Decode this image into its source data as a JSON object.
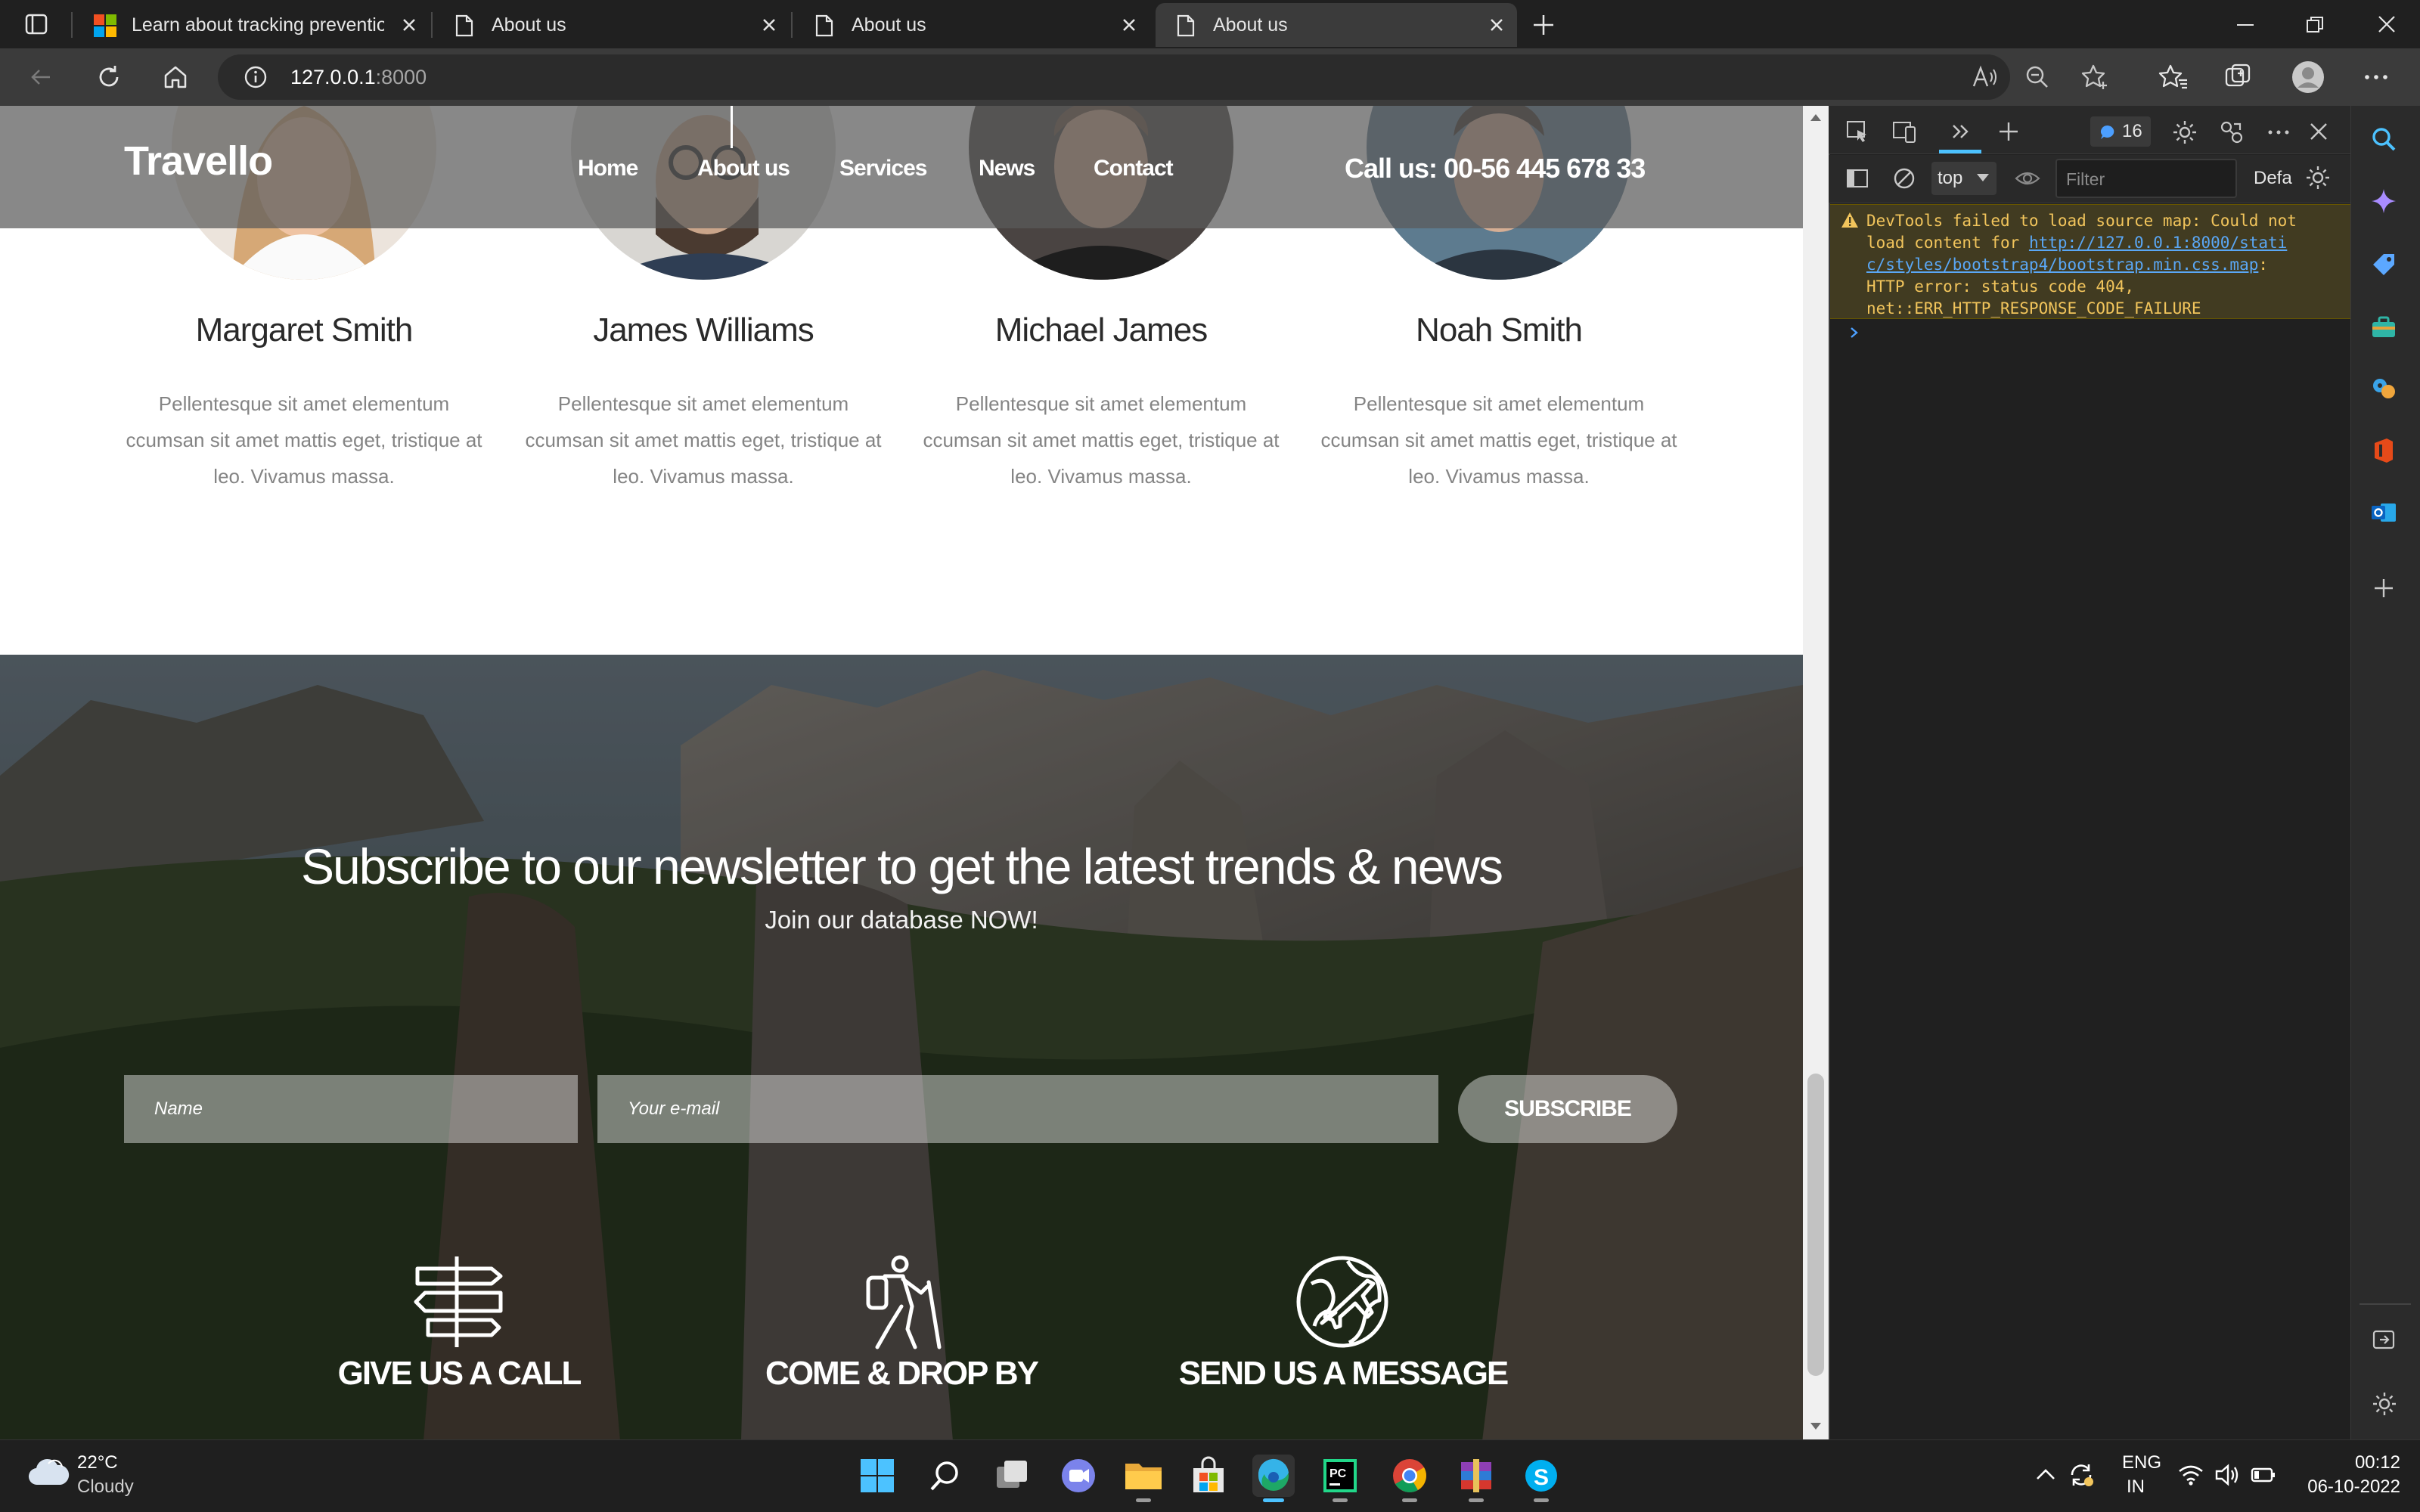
{
  "browser": {
    "tabs": [
      {
        "title": "Learn about tracking prevention"
      },
      {
        "title": "About us"
      },
      {
        "title": "About us"
      },
      {
        "title": "About us"
      }
    ],
    "url_host": "127.0.0.1",
    "url_port": ":8000"
  },
  "site": {
    "logo": "Travello",
    "nav": [
      "Home",
      "About us",
      "Services",
      "News",
      "Contact"
    ],
    "phone": "Call us: 00-56 445 678 33",
    "team": [
      {
        "name": "Margaret Smith",
        "desc": "Pellentesque sit amet elementum ccumsan sit amet mattis eget, tristique at leo. Vivamus massa."
      },
      {
        "name": "James Williams",
        "desc": "Pellentesque sit amet elementum ccumsan sit amet mattis eget, tristique at leo. Vivamus massa."
      },
      {
        "name": "Michael James",
        "desc": "Pellentesque sit amet elementum ccumsan sit amet mattis eget, tristique at leo. Vivamus massa."
      },
      {
        "name": "Noah Smith",
        "desc": "Pellentesque sit amet elementum ccumsan sit amet mattis eget, tristique at leo. Vivamus massa."
      }
    ],
    "newsletter": {
      "headline": "Subscribe to our newsletter to get the latest trends & news",
      "subline": "Join our database NOW!",
      "name_placeholder": "Name",
      "email_placeholder": "Your e-mail",
      "button": "SUBSCRIBE"
    },
    "features": [
      {
        "label": "GIVE US A CALL",
        "icon": "signpost-icon"
      },
      {
        "label": "COME & DROP BY",
        "icon": "hiker-icon"
      },
      {
        "label": "SEND US A MESSAGE",
        "icon": "globe-plane-icon"
      }
    ]
  },
  "devtools": {
    "issues_count": "16",
    "context": "top",
    "filter_placeholder": "Filter",
    "levels": "Defa",
    "warning_lines": [
      "DevTools failed to load source map: Could not",
      "load content for ",
      "http://127.0.0.1:8000/stati",
      "c/styles/bootstrap4/bootstrap.min.css.map",
      ":",
      "HTTP error: status code 404,",
      "net::ERR_HTTP_RESPONSE_CODE_FAILURE"
    ]
  },
  "taskbar": {
    "weather_temp": "22°C",
    "weather_desc": "Cloudy",
    "lang": "ENG",
    "region": "IN",
    "time": "00:12",
    "date": "06-10-2022"
  },
  "colors": {
    "accent_blue": "#4cc2ff",
    "warning": "#f2c55c",
    "link": "#5aa7f5"
  }
}
